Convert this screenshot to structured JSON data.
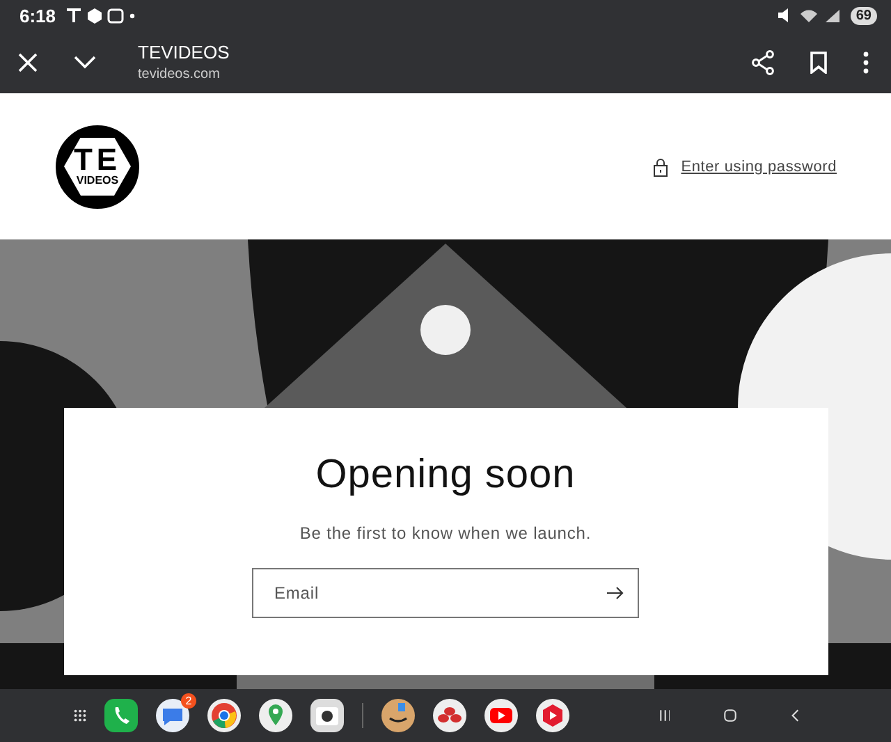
{
  "status_bar": {
    "time": "6:18",
    "battery": "69"
  },
  "browser_bar": {
    "title": "TEVIDEOS",
    "url": "tevideos.com"
  },
  "header": {
    "logo_text": "TE",
    "logo_subtext": "VIDEOS",
    "password_link": "Enter using password"
  },
  "card": {
    "heading": "Opening soon",
    "subtitle": "Be the first to know when we launch.",
    "email": {
      "placeholder": "Email"
    }
  },
  "taskbar": {
    "apps": [
      {
        "kind": "phone"
      },
      {
        "kind": "messages",
        "badge": "2"
      },
      {
        "kind": "chrome"
      },
      {
        "kind": "maps"
      },
      {
        "kind": "camera"
      },
      {
        "kind": "divider"
      },
      {
        "kind": "amazon"
      },
      {
        "kind": "bank"
      },
      {
        "kind": "youtube"
      },
      {
        "kind": "ytmusic"
      }
    ]
  }
}
